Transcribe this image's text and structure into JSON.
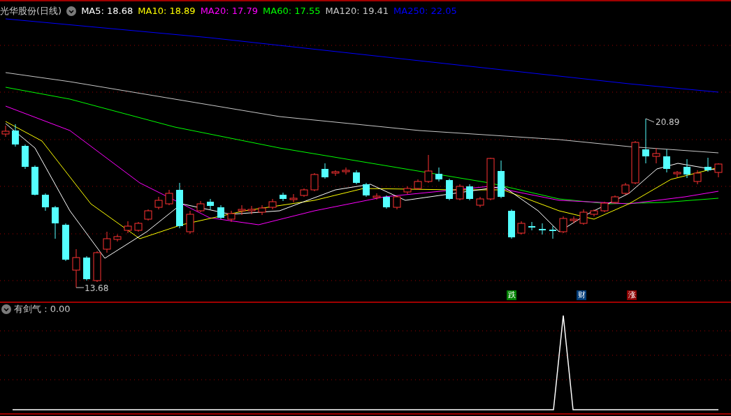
{
  "main_chart": {
    "title": "光华股份(日线)",
    "ma_legend": [
      {
        "label": "MA5: 18.68",
        "color": "#ffffff"
      },
      {
        "label": "MA10: 18.89",
        "color": "#ffff00"
      },
      {
        "label": "MA20: 17.79",
        "color": "#ff00ff"
      },
      {
        "label": "MA60: 17.55",
        "color": "#00ff00"
      },
      {
        "label": "MA120: 19.41",
        "color": "#c8c8c8"
      },
      {
        "label": "MA250: 22.05",
        "color": "#0000ff"
      }
    ],
    "high_label": "20.89",
    "low_label": "13.68",
    "event_markers": [
      {
        "label": "跌",
        "color": "#008000"
      },
      {
        "label": "财",
        "color": "#003c78"
      },
      {
        "label": "涨",
        "color": "#8c0000"
      }
    ]
  },
  "indicator": {
    "label": "有剑气 : 0.00"
  }
}
